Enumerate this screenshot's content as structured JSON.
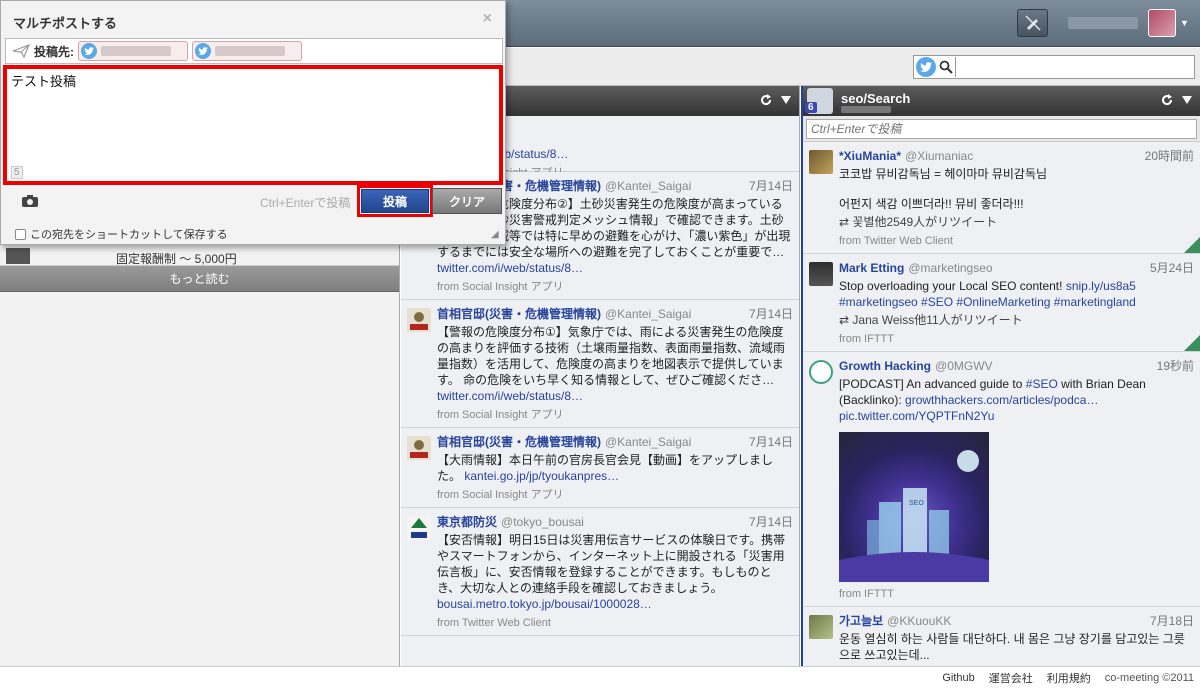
{
  "modal": {
    "title": "マルチポストする",
    "dest_label": "投稿先:",
    "compose_text": "テスト投稿",
    "char_count": "5",
    "hint": "Ctrl+Enterで投稿",
    "post_label": "投稿",
    "clear_label": "クリア",
    "shortcut_label": "この宛先をショートカットして保存する",
    "close_glyph": "×"
  },
  "left": {
    "peek_text": "固定報酬制 〜 5,000円",
    "more_label": "もっと読む"
  },
  "mid": {
    "tweets": [
      {
        "name": "",
        "screen": "",
        "time": "",
        "body": "",
        "link": "tter.com/i/web/status/8…",
        "from_label": "from Social Insight アプリ",
        "from_text": "from Social Insight アプリ"
      },
      {
        "name": "首相官邸(災害・危機管理情報)",
        "screen": "@Kantei_Saigai",
        "time": "7月14日",
        "body": "【土砂災害危険度分布②】土砂災害発生の危険度が高まっている場所は「土砂災害警戒判定メッシュ情報」で確認できます。土砂災害警戒区域等では特に早めの避難を心がけ、「濃い紫色」が出現するまでには安全な場所への避難を完了しておくことが重要で…",
        "link": "twitter.com/i/web/status/8…",
        "from_text": "from Social Insight アプリ"
      },
      {
        "name": "首相官邸(災害・危機管理情報)",
        "screen": "@Kantei_Saigai",
        "time": "7月14日",
        "body": "【警報の危険度分布①】気象庁では、雨による災害発生の危険度の高まりを評価する技術（土壌雨量指数、表面雨量指数、流域雨量指数）を活用して、危険度の高まりを地図表示で提供しています。 命の危険をいち早く知る情報として、ぜひご確認くださ…",
        "link": "twitter.com/i/web/status/8…",
        "from_text": "from Social Insight アプリ"
      },
      {
        "name": "首相官邸(災害・危機管理情報)",
        "screen": "@Kantei_Saigai",
        "time": "7月14日",
        "body": "【大雨情報】本日午前の官房長官会見【動画】をアップしました。",
        "link": "kantei.go.jp/jp/tyoukanpres…",
        "from_text": "from Social Insight アプリ"
      },
      {
        "name": "東京都防災",
        "screen": "@tokyo_bousai",
        "time": "7月14日",
        "body": "【安否情報】明日15日は災害用伝言サービスの体験日です。携帯やスマートフォンから、インターネット上に開設される「災害用伝言板」に、安否情報を登録することができます。もしものとき、大切な人との連絡手段を確認しておきましょう。",
        "link": "bousai.metro.tokyo.jp/bousai/1000028…",
        "from_text": "from Twitter Web Client"
      }
    ]
  },
  "right": {
    "title": "seo/Search",
    "badge": "6",
    "input_placeholder": "Ctrl+Enterで投稿",
    "tweets": [
      {
        "name": "*XiuMania*",
        "screen": "@Xiumaniac",
        "time": "20時間前",
        "body1": "코코밥 뮤비감독님 = 헤이마마 뮤비감독님",
        "body2": "어펀지 색감 이쁘더라!! 뮤비 좋더라!!!",
        "rt": "꽃별他2549人がリツイート",
        "from_text": "from Twitter Web Client"
      },
      {
        "name": "Mark Etting",
        "screen": "@marketingseo",
        "time": "5月24日",
        "body": "Stop overloading your Local SEO content! ",
        "link": "snip.ly/us8a5",
        "tags": "#marketingseo #SEO #OnlineMarketing #marketingland",
        "rt": "Jana Weiss他11人がリツイート",
        "from_text": "from IFTTT"
      },
      {
        "name": "Growth Hacking",
        "screen": "@0MGWV",
        "time": "19秒前",
        "body_a": "[PODCAST] An advanced guide to ",
        "tag": "#SEO",
        "body_b": " with Brian Dean (Backlinko): ",
        "link": "growthhackers.com/articles/podca…",
        "link2": "pic.twitter.com/YQPTFnN2Yu",
        "img_sign": "SEO",
        "from_text": "from IFTTT"
      },
      {
        "name": "가고늘보",
        "screen": "@KKuouKK",
        "time": "7月18日",
        "body": "운동 열심히 하는 사람들 대단하다. 내 몸은 그냥 장기를 담고있는 그릇으로 쓰고있는데...",
        "from_text": ""
      }
    ]
  },
  "search": {
    "placeholder": ""
  },
  "footer": {
    "github": "Github",
    "company": "運営会社",
    "terms": "利用規約",
    "copyright": "co-meeting ©2011"
  },
  "icons": {
    "twitter": "twitter-bird-icon",
    "search": "search-icon",
    "refresh": "refresh-icon",
    "dropdown": "dropdown-caret-icon",
    "camera": "camera-icon",
    "send": "paper-plane-icon",
    "retweet": "retweet-icon",
    "mute": "pen-slash-icon"
  },
  "colors": {
    "accent_red": "#e00000",
    "post_blue": "#2a4f9e",
    "link": "#27449b",
    "column_border": "#1e3fb3"
  }
}
